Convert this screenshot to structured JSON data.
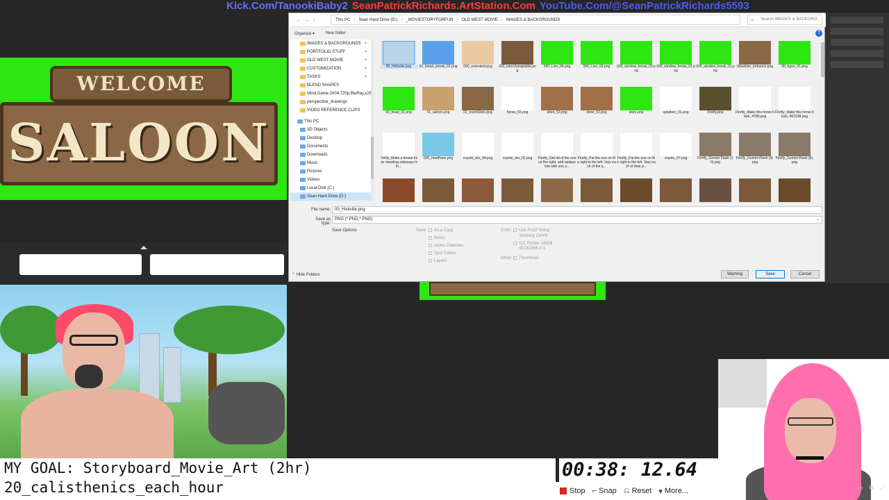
{
  "banner": {
    "kick": "Kick.Com/TanookiBaby2",
    "artstation": "SeanPatrickRichards.ArtStation.Com",
    "youtube": "YouTube.Com/@SeanPatrickRichards5593"
  },
  "saloon_sign": {
    "welcome": "WELCOME",
    "saloon": "SALOON"
  },
  "dialog": {
    "breadcrumbs": [
      "This PC",
      "Sean Hard Drive (D:)",
      "_MOVIESTORYFORFUN",
      "OLD WEST MOVIE",
      "IMAGES & BACKGROUNDS"
    ],
    "search_placeholder": "Search IMAGES & BACKGRO...",
    "organize": "Organize ▾",
    "new_folder": "New folder",
    "nav_quick": [
      "IMAGES & BACKGROUNDS",
      "PORTFOLIO STUFF",
      "OLD WEST MOVIE",
      "CUSTOMIZATION",
      "TASKS",
      "BLEND SHAPES",
      "Mind.Game.2004.720p.BluRay.x26",
      "perspective_drawings",
      "VIDEO REFERENCE CLIPS"
    ],
    "nav_pc_label": "This PC",
    "nav_pc": [
      "3D Objects",
      "Desktop",
      "Documents",
      "Downloads",
      "Music",
      "Pictures",
      "Videos",
      "Local Disk (C:)",
      "Sean Hard Drive (D:)"
    ],
    "files_row1": [
      "00_Hickville.png",
      "00_blood_streak_01.png",
      "000_extended.png",
      "000_interchangeable.png",
      "000_Lion_04.png",
      "000_Lion_03.png",
      "000_window_break_03.png",
      "000_window_break_02.png",
      "000_window_break_01.png",
      "00saloon_entrance.png",
      "00_hgun_01.png"
    ],
    "files_row2": [
      "00_head_01.png",
      "01_saloon.png",
      "01_roomStore.png",
      "horse_02.png",
      "store_03.png",
      "store_02.png",
      "store.png",
      "splatters_01.png",
      "Firefly.png",
      "Firefly_Make this horse black, 4786.png",
      "Firefly_Make this horse black, 463148.png"
    ],
    "files_row3": [
      "Firefly_Make a brown horse standing sideways in th...",
      "000_heatHaze.png",
      "coyote_trio_04.png",
      "coyote_trio_02.png",
      "Firefly_Get rid of the one on the right, and replace him with one s...",
      "Firefly_Put the one on the right to the left. Vary each of the p...",
      "Firefly_Put the one on the right to the left. Vary each of their p...",
      "coyote_07.png",
      "Firefly_Gemini Flash (10).png",
      "Firefly_Gemini Flash (9).png",
      "Firefly_Gemini Flash (8).png"
    ],
    "file_name_label": "File name:",
    "file_name_value": "00_Hickville.png",
    "save_type_label": "Save as type:",
    "save_type_value": "PNG (*.PNG;*.PNG)",
    "save_options": "Save Options",
    "save_label": "Save:",
    "as_copy": "As a Copy",
    "notes": "Notes",
    "alpha": "Alpha Channels",
    "spot": "Spot Colors",
    "layers": "Layers",
    "color_label": "Color:",
    "use_proof": "Use Proof Setup:",
    "working_cmyk": "Working CMYK",
    "icc": "ICC Profile: sRGB",
    "icc2": "IEC61966-2.1",
    "other_label": "Other:",
    "thumbnail": "Thumbnail",
    "hide_folders": "Hide Folders",
    "warning_btn": "Warning",
    "save_btn": "Save",
    "cancel_btn": "Cancel"
  },
  "goal": {
    "line1": "MY GOAL: Storyboard_Movie_Art (2hr)",
    "line2": "20_calisthenics_each_hour"
  },
  "timer": {
    "time": "00:38: 12.64",
    "stop": "Stop",
    "snap": "Snap",
    "reset": "Reset",
    "more": "More..."
  }
}
